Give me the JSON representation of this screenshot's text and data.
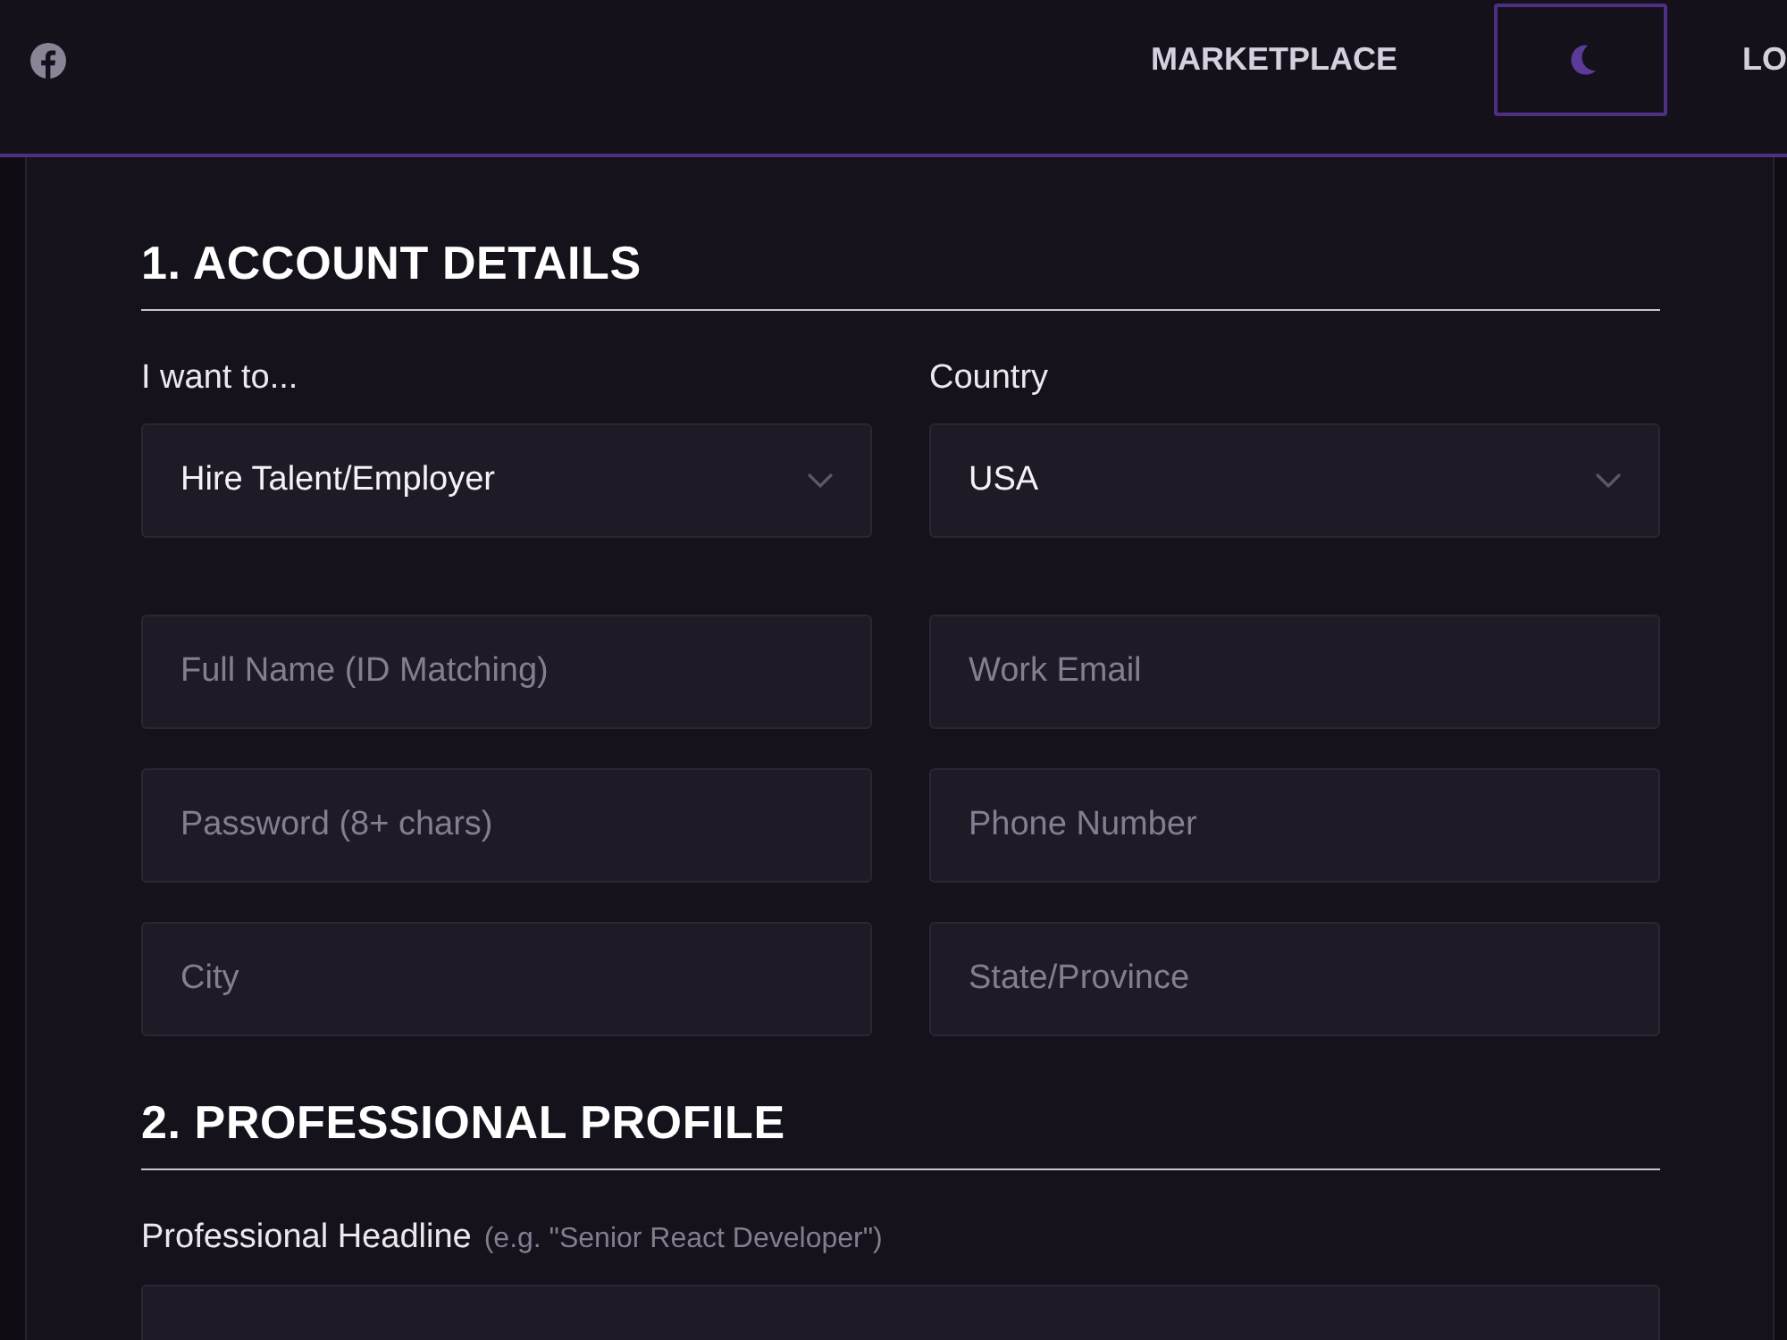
{
  "header": {
    "nav": [
      {
        "kind": "link",
        "label": "MARKETPLACE"
      },
      {
        "kind": "theme_toggle"
      },
      {
        "kind": "link",
        "label": "LO"
      }
    ]
  },
  "sections": [
    {
      "title": "1. ACCOUNT DETAILS",
      "rows": [
        [
          {
            "kind": "select",
            "label": "I want to...",
            "value": "Hire Talent/Employer"
          },
          {
            "kind": "select",
            "label": "Country",
            "value": "USA"
          }
        ],
        [
          {
            "kind": "input",
            "placeholder": "Full Name (ID Matching)"
          },
          {
            "kind": "input",
            "placeholder": "Work Email"
          }
        ],
        [
          {
            "kind": "input",
            "placeholder": "Password (8+ chars)"
          },
          {
            "kind": "input",
            "placeholder": "Phone Number"
          }
        ],
        [
          {
            "kind": "input",
            "placeholder": "City"
          },
          {
            "kind": "input",
            "placeholder": "State/Province"
          }
        ]
      ]
    },
    {
      "title": "2. PROFESSIONAL PROFILE",
      "rows": [
        [
          {
            "kind": "input",
            "label": "Professional Headline",
            "hint": "(e.g. \"Senior React Developer\")"
          }
        ]
      ]
    }
  ]
}
